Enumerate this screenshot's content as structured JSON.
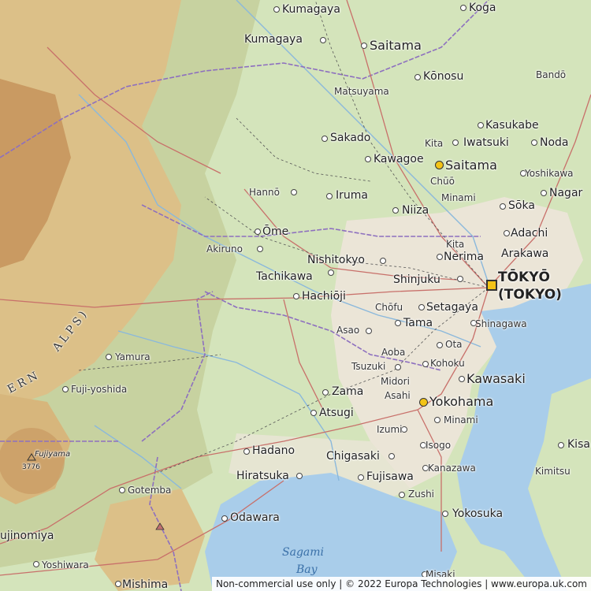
{
  "map": {
    "colors": {
      "sea": "#a9cdea",
      "lowland": "#d4e4bb",
      "hills": "#c9d3a0",
      "mountain": "#d9b97a",
      "highpeak": "#b98b57",
      "urban": "#efe7df",
      "road": "#c8706a",
      "border": "#8d6fbf",
      "river": "#8ab8dc"
    },
    "cities": [
      {
        "id": "kumagaya-n",
        "name": "Kumagaya",
        "size": "md"
      },
      {
        "id": "koga",
        "name": "Koga",
        "size": "md"
      },
      {
        "id": "kumagaya",
        "name": "Kumagaya",
        "size": "md"
      },
      {
        "id": "saitama-n",
        "name": "Saitama",
        "size": "lg"
      },
      {
        "id": "konosu",
        "name": "Kōnosu",
        "size": "md"
      },
      {
        "id": "bando",
        "name": "Bandō",
        "size": "sm"
      },
      {
        "id": "matsuyama",
        "name": "Matsuyama",
        "size": "sm"
      },
      {
        "id": "kasukabe",
        "name": "Kasukabe",
        "size": "md"
      },
      {
        "id": "sakado",
        "name": "Sakado",
        "size": "md"
      },
      {
        "id": "kita-n",
        "name": "Kita",
        "size": "sm"
      },
      {
        "id": "iwatsuki",
        "name": "Iwatsuki",
        "size": "md"
      },
      {
        "id": "noda",
        "name": "Noda",
        "size": "md"
      },
      {
        "id": "kawagoe",
        "name": "Kawagoe",
        "size": "md"
      },
      {
        "id": "saitama",
        "name": "Saitama",
        "size": "lg"
      },
      {
        "id": "yoshikawa",
        "name": "Yoshikawa",
        "size": "sm"
      },
      {
        "id": "chuo",
        "name": "Chūō",
        "size": "sm"
      },
      {
        "id": "hanno",
        "name": "Hannō",
        "size": "sm"
      },
      {
        "id": "iruma",
        "name": "Iruma",
        "size": "md"
      },
      {
        "id": "minami-n",
        "name": "Minami",
        "size": "sm"
      },
      {
        "id": "nagar",
        "name": "Nagar",
        "size": "md"
      },
      {
        "id": "soka",
        "name": "Sōka",
        "size": "md"
      },
      {
        "id": "niiza",
        "name": "Niiza",
        "size": "md"
      },
      {
        "id": "ome",
        "name": "Ōme",
        "size": "md"
      },
      {
        "id": "adachi",
        "name": "Adachi",
        "size": "md"
      },
      {
        "id": "kita",
        "name": "Kita",
        "size": "sm"
      },
      {
        "id": "akiruno",
        "name": "Akiruno",
        "size": "sm"
      },
      {
        "id": "nerima",
        "name": "Nerima",
        "size": "md"
      },
      {
        "id": "arakawa",
        "name": "Arakawa",
        "size": "md"
      },
      {
        "id": "nishitokyo",
        "name": "Nishitokyo",
        "size": "md"
      },
      {
        "id": "tachikawa",
        "name": "Tachikawa",
        "size": "md"
      },
      {
        "id": "shinjuku",
        "name": "Shinjuku",
        "size": "md"
      },
      {
        "id": "tokyo",
        "name": "TŌKYŌ",
        "size": "cap"
      },
      {
        "id": "tokyo2",
        "name": "(TOKYO)",
        "size": "cap"
      },
      {
        "id": "hachioji",
        "name": "Hachiōji",
        "size": "md"
      },
      {
        "id": "chofu",
        "name": "Chōfu",
        "size": "sm"
      },
      {
        "id": "setagaya",
        "name": "Setagaya",
        "size": "md"
      },
      {
        "id": "asao",
        "name": "Asao",
        "size": "sm"
      },
      {
        "id": "tama",
        "name": "Tama",
        "size": "md"
      },
      {
        "id": "shinagawa",
        "name": "Shinagawa",
        "size": "sm"
      },
      {
        "id": "ota",
        "name": "Ota",
        "size": "sm"
      },
      {
        "id": "aoba",
        "name": "Aoba",
        "size": "sm"
      },
      {
        "id": "yamura",
        "name": "Yamura",
        "size": "sm"
      },
      {
        "id": "kohoku",
        "name": "Kohoku",
        "size": "sm"
      },
      {
        "id": "tsuzuki",
        "name": "Tsuzuki",
        "size": "sm"
      },
      {
        "id": "kawasaki",
        "name": "Kawasaki",
        "size": "lg"
      },
      {
        "id": "midori",
        "name": "Midori",
        "size": "sm"
      },
      {
        "id": "fuji-yoshida",
        "name": "Fuji-yoshida",
        "size": "sm"
      },
      {
        "id": "zama",
        "name": "Zama",
        "size": "md"
      },
      {
        "id": "asahi",
        "name": "Asahi",
        "size": "sm"
      },
      {
        "id": "yokohama",
        "name": "Yokohama",
        "size": "lg"
      },
      {
        "id": "atsugi",
        "name": "Atsugi",
        "size": "md"
      },
      {
        "id": "minami-s",
        "name": "Minami",
        "size": "sm"
      },
      {
        "id": "izumi",
        "name": "Izumi",
        "size": "sm"
      },
      {
        "id": "hadano",
        "name": "Hadano",
        "size": "md"
      },
      {
        "id": "chigasaki",
        "name": "Chigasaki",
        "size": "md"
      },
      {
        "id": "isogo",
        "name": "Isogo",
        "size": "sm"
      },
      {
        "id": "kisa",
        "name": "Kisa",
        "size": "md"
      },
      {
        "id": "kanazawa",
        "name": "Kanazawa",
        "size": "sm"
      },
      {
        "id": "kimitsu",
        "name": "Kimitsu",
        "size": "sm"
      },
      {
        "id": "hiratsuka",
        "name": "Hiratsuka",
        "size": "md"
      },
      {
        "id": "fujisawa",
        "name": "Fujisawa",
        "size": "md"
      },
      {
        "id": "gotemba",
        "name": "Gotemba",
        "size": "sm"
      },
      {
        "id": "zushi",
        "name": "Zushi",
        "size": "sm"
      },
      {
        "id": "yokosuka",
        "name": "Yokosuka",
        "size": "md"
      },
      {
        "id": "odawara",
        "name": "Odawara",
        "size": "md"
      },
      {
        "id": "fujinomiya",
        "name": "ujinomiya",
        "size": "md"
      },
      {
        "id": "yoshiwara",
        "name": "Yoshiwara",
        "size": "sm"
      },
      {
        "id": "mishima",
        "name": "Mishima",
        "size": "md"
      },
      {
        "id": "misaki",
        "name": "Misaki",
        "size": "sm"
      }
    ],
    "peak": {
      "name": "Fujiyama",
      "elevation": "3776"
    },
    "range_labels": [
      "ERN",
      "ALPS)"
    ],
    "water_labels": [
      "Sagami",
      "Bay"
    ]
  },
  "footer": {
    "attribution": "Non-commercial use only | © 2022 Europa Technologies | www.europa.uk.com"
  }
}
